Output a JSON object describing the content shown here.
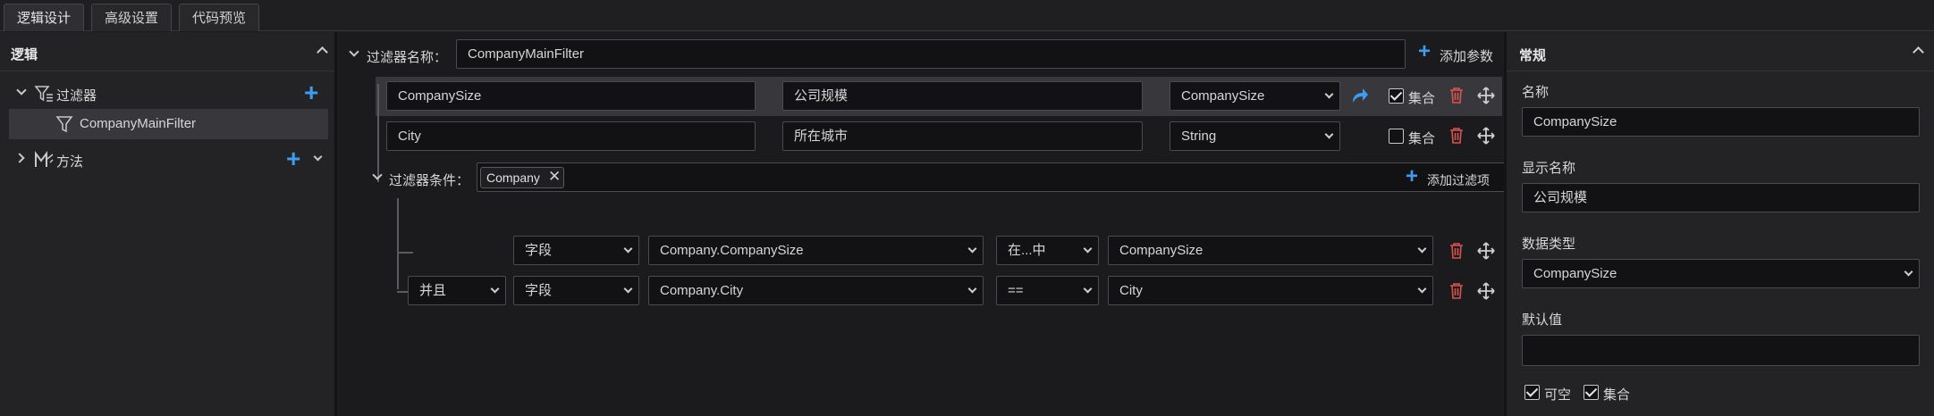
{
  "tabs": [
    {
      "label": "逻辑设计"
    },
    {
      "label": "高级设置"
    },
    {
      "label": "代码预览"
    }
  ],
  "left": {
    "title": "逻辑",
    "tree": {
      "filters_label": "过滤器",
      "filter_item": "CompanyMainFilter",
      "methods_label": "方法"
    }
  },
  "mid": {
    "filter_name_label": "过滤器名称：",
    "filter_name_value": "CompanyMainFilter",
    "add_param_label": "添加参数",
    "params": [
      {
        "name": "CompanySize",
        "display": "公司规模",
        "type": "CompanySize",
        "collection_label": "集合",
        "collection": true
      },
      {
        "name": "City",
        "display": "所在城市",
        "type": "String",
        "collection_label": "集合",
        "collection": false
      }
    ],
    "condition_label": "过滤器条件：",
    "condition_tag": "Company",
    "add_condition_label": "添加过滤项",
    "conditions": [
      {
        "logic": "",
        "kind": "字段",
        "field": "Company.CompanySize",
        "op": "在...中",
        "value": "CompanySize"
      },
      {
        "logic": "并且",
        "kind": "字段",
        "field": "Company.City",
        "op": "==",
        "value": "City"
      }
    ]
  },
  "right": {
    "title": "常规",
    "name_label": "名称",
    "name_value": "CompanySize",
    "display_label": "显示名称",
    "display_value": "公司规模",
    "type_label": "数据类型",
    "type_value": "CompanySize",
    "default_label": "默认值",
    "default_value": "",
    "nullable_label": "可空",
    "collection_label": "集合"
  },
  "colors": {
    "accent": "#3d9cf0",
    "danger": "#d9534f",
    "selected_row": "#38383c"
  }
}
